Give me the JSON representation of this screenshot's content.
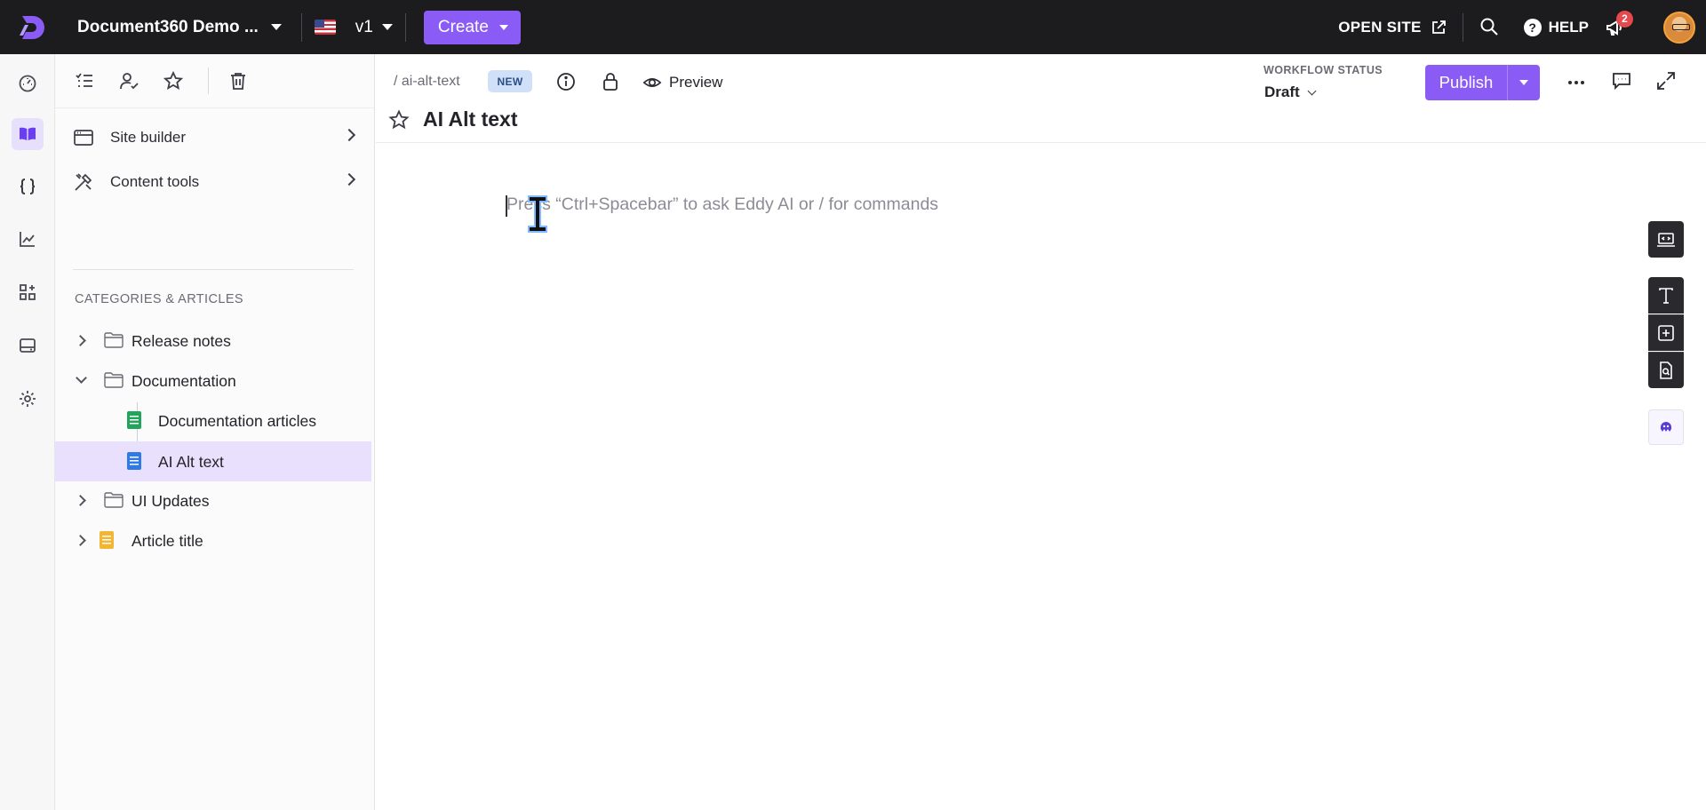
{
  "topbar": {
    "project_name": "Document360 Demo ...",
    "version": "v1",
    "create_label": "Create",
    "open_site_label": "OPEN SITE",
    "help_label": "HELP",
    "notification_count": "2"
  },
  "sidebar": {
    "links": [
      {
        "label": "Site builder"
      },
      {
        "label": "Content tools"
      }
    ],
    "section_heading": "CATEGORIES & ARTICLES",
    "tree": [
      {
        "label": "Release notes"
      },
      {
        "label": "Documentation"
      },
      {
        "label": "Documentation articles"
      },
      {
        "label": "AI Alt text"
      },
      {
        "label": "UI Updates"
      },
      {
        "label": "Article title"
      }
    ]
  },
  "article": {
    "slug": "/ ai-alt-text",
    "status_badge": "NEW",
    "preview_label": "Preview",
    "workflow_label": "WORKFLOW STATUS",
    "workflow_value": "Draft",
    "publish_label": "Publish",
    "title": "AI Alt text",
    "editor_placeholder": "Press “Ctrl+Spacebar” to ask Eddy AI or / for commands"
  },
  "colors": {
    "accent": "#8a5cf5",
    "topbar": "#1c1c1e",
    "selected_row": "#e8e0fc",
    "new_badge": "#cfe0f8",
    "notification_badge": "#e5484d"
  }
}
